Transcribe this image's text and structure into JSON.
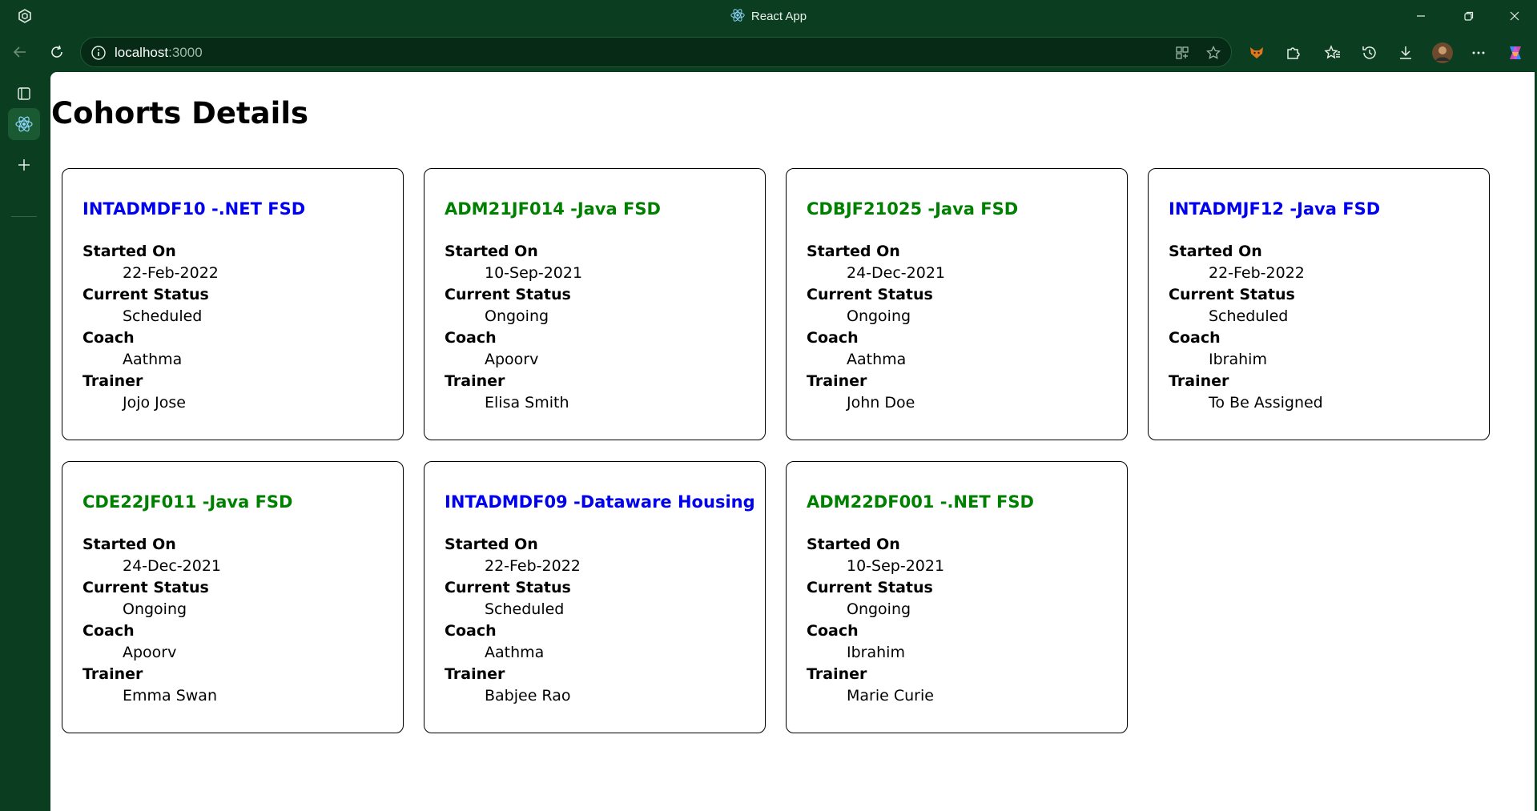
{
  "window": {
    "title": "React App"
  },
  "browser": {
    "address": {
      "host": "localhost",
      "port": ":3000"
    }
  },
  "page": {
    "heading": "Cohorts Details",
    "field_labels": {
      "started_on": "Started On",
      "current_status": "Current Status",
      "coach": "Coach",
      "trainer": "Trainer"
    },
    "cohorts": [
      {
        "name": "INTADMDF10 -.NET FSD",
        "started_on": "22-Feb-2022",
        "current_status": "Scheduled",
        "coach": "Aathma",
        "trainer": "Jojo Jose",
        "color": "#0000ee"
      },
      {
        "name": "ADM21JF014 -Java FSD",
        "started_on": "10-Sep-2021",
        "current_status": "Ongoing",
        "coach": "Apoorv",
        "trainer": "Elisa Smith",
        "color": "#008000"
      },
      {
        "name": "CDBJF21025 -Java FSD",
        "started_on": "24-Dec-2021",
        "current_status": "Ongoing",
        "coach": "Aathma",
        "trainer": "John Doe",
        "color": "#008000"
      },
      {
        "name": "INTADMJF12 -Java FSD",
        "started_on": "22-Feb-2022",
        "current_status": "Scheduled",
        "coach": "Ibrahim",
        "trainer": "To Be Assigned",
        "color": "#0000ee"
      },
      {
        "name": "CDE22JF011 -Java FSD",
        "started_on": "24-Dec-2021",
        "current_status": "Ongoing",
        "coach": "Apoorv",
        "trainer": "Emma Swan",
        "color": "#008000"
      },
      {
        "name": "INTADMDF09 -Dataware Housing",
        "started_on": "22-Feb-2022",
        "current_status": "Scheduled",
        "coach": "Aathma",
        "trainer": "Babjee Rao",
        "color": "#0000ee"
      },
      {
        "name": "ADM22DF001 -.NET FSD",
        "started_on": "10-Sep-2021",
        "current_status": "Ongoing",
        "coach": "Ibrahim",
        "trainer": "Marie Curie",
        "color": "#008000"
      }
    ]
  }
}
